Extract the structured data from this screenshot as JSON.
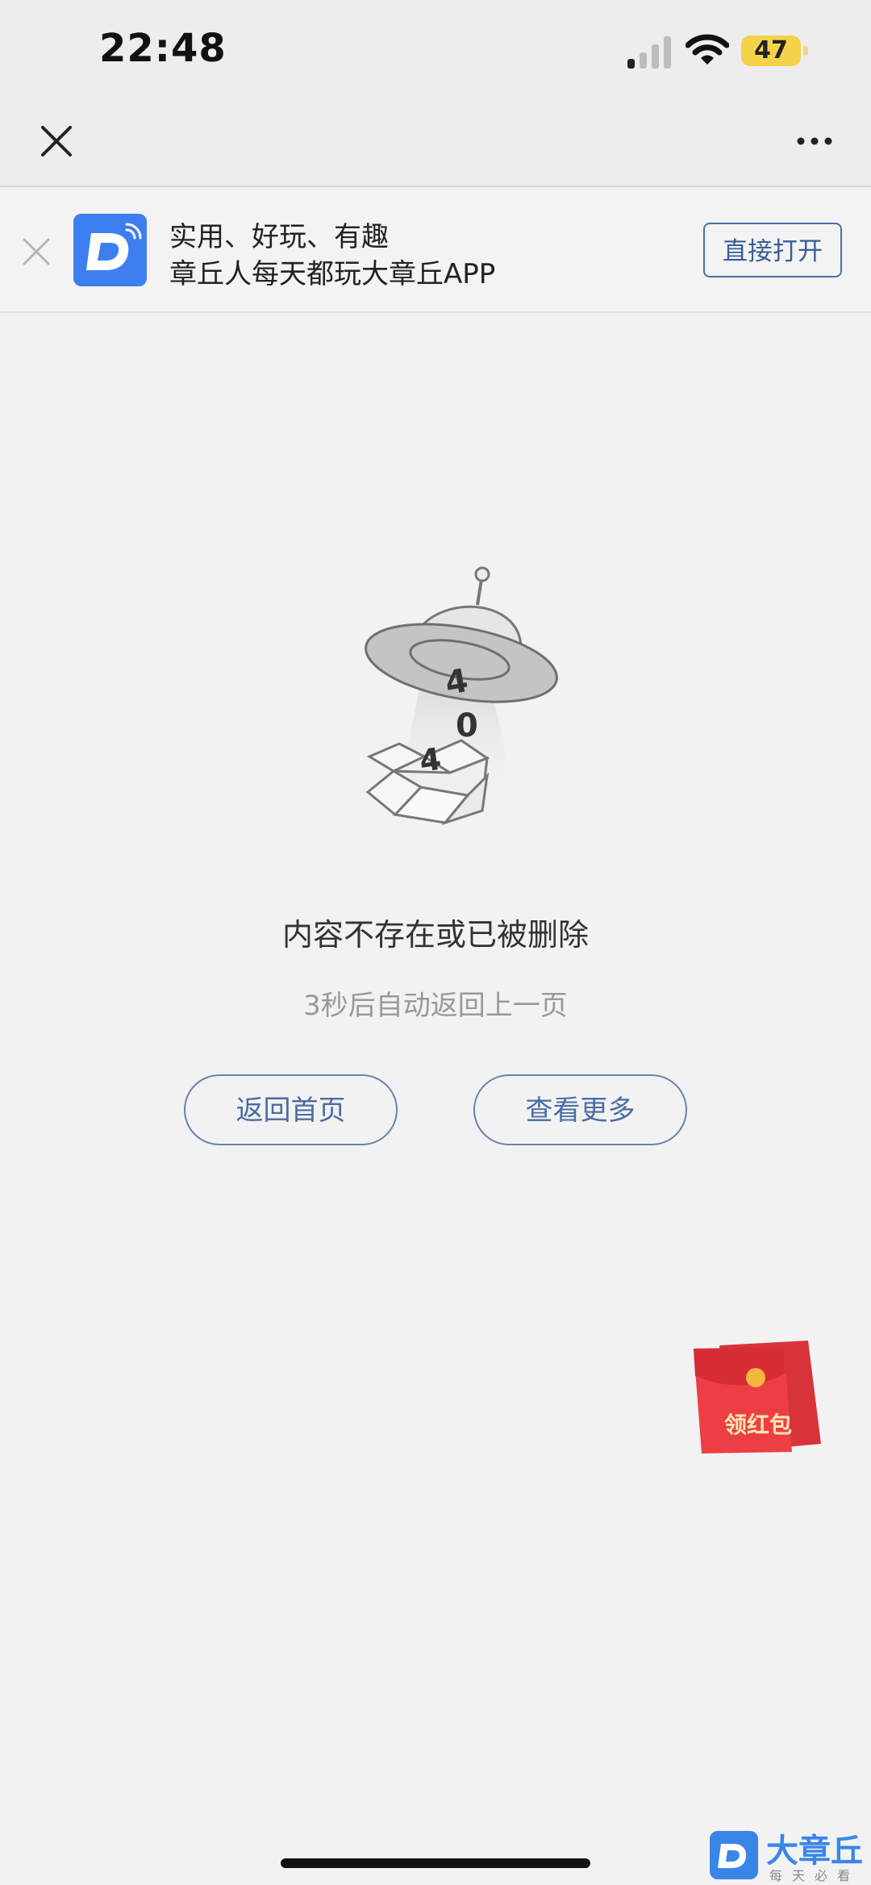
{
  "status_bar": {
    "time": "22:48",
    "battery": "47"
  },
  "banner": {
    "line1": "实用、好玩、有趣",
    "line2": "章丘人每天都玩大章丘APP",
    "open_label": "直接打开"
  },
  "illustration": {
    "digit_top": "4",
    "digit_middle": "0",
    "digit_bottom": "4"
  },
  "main": {
    "title": "内容不存在或已被删除",
    "countdown": "3秒后自动返回上一页",
    "home_label": "返回首页",
    "more_label": "查看更多"
  },
  "red_envelope": {
    "label": "领红包"
  },
  "watermark": {
    "name": "大章丘",
    "slogan": "每天必看"
  },
  "colors": {
    "accent": "#4a6ca4",
    "app_blue": "#3d7ff0",
    "envelope_red": "#e8343b",
    "battery": "#f4d34a"
  }
}
